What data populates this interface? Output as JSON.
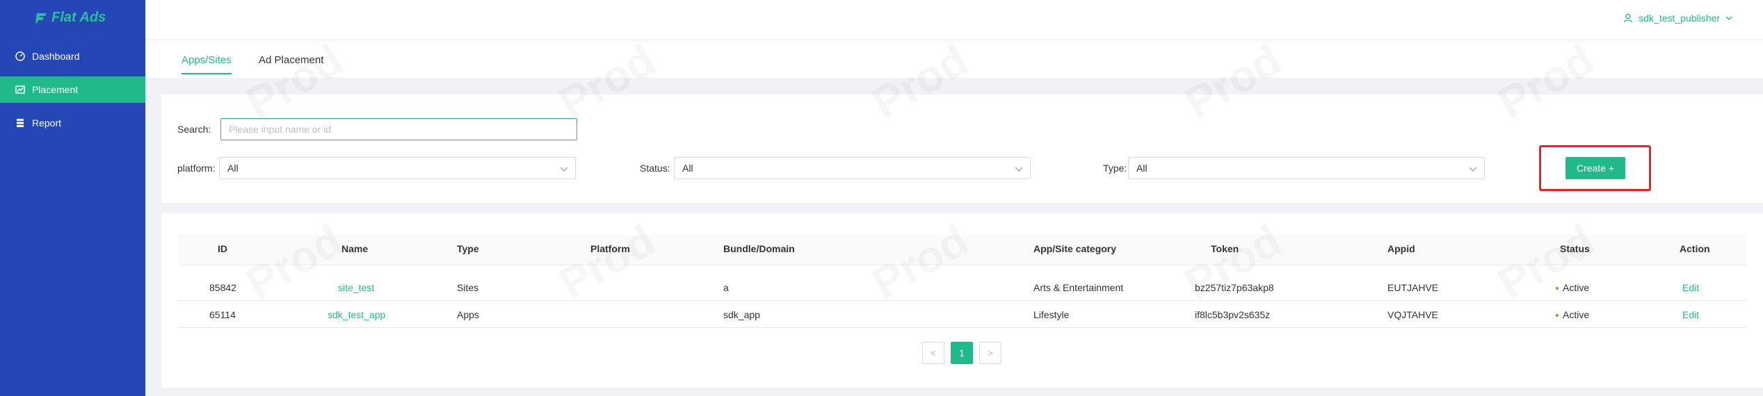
{
  "sidebar": {
    "brand": "Flat Ads",
    "items": [
      {
        "label": "Dashboard",
        "icon": "dashboard-icon"
      },
      {
        "label": "Placement",
        "icon": "chart-icon",
        "active": true
      },
      {
        "label": "Report",
        "icon": "report-icon"
      }
    ]
  },
  "header": {
    "user": "sdk_test_publisher"
  },
  "tabs": [
    {
      "label": "Apps/Sites",
      "active": true
    },
    {
      "label": "Ad Placement",
      "active": false
    }
  ],
  "filters": {
    "search_label": "Search:",
    "search_placeholder": "Please input name or id",
    "search_value": "",
    "platform_label": "platform:",
    "platform_value": "All",
    "status_label": "Status:",
    "status_value": "All",
    "type_label": "Type:",
    "type_value": "All",
    "create_label": "Create +"
  },
  "table": {
    "columns": [
      "ID",
      "Name",
      "Type",
      "Platform",
      "Bundle/Domain",
      "App/Site category",
      "Token",
      "Appid",
      "Status",
      "Action"
    ],
    "rows": [
      {
        "id": "85842",
        "name": "site_test",
        "type": "Sites",
        "platform": "",
        "bundle": "a",
        "category": "Arts & Entertainment",
        "token": "bz257tiz7p63akp8",
        "appid": "EUTJAHVE",
        "status": "Active",
        "action": "Edit"
      },
      {
        "id": "65114",
        "name": "sdk_test_app",
        "type": "Apps",
        "platform": "",
        "bundle": "sdk_app",
        "category": "Lifestyle",
        "token": "if8lc5b3pv2s635z",
        "appid": "VQJTAHVE",
        "status": "Active",
        "action": "Edit"
      }
    ]
  },
  "pagination": {
    "prev": "<",
    "current": "1",
    "next": ">"
  },
  "watermark": "Prod",
  "colors": {
    "sidebar": "#2447b5",
    "accent": "#1fb98a",
    "highlight": "#ff1a1a"
  }
}
